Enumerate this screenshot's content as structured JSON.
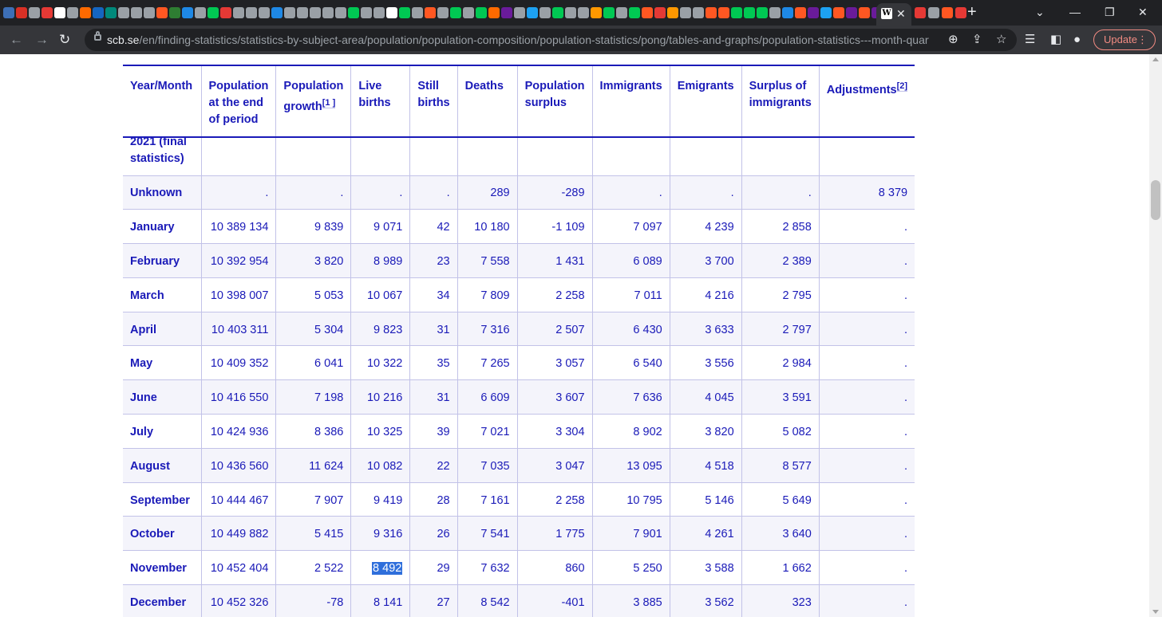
{
  "browser": {
    "active_tab_icon": "W",
    "url_host": "scb.se",
    "url_path": "/en/finding-statistics/statistics-by-subject-area/population/population-composition/population-statistics/pong/tables-and-graphs/population-statistics---month-quarter-...",
    "update_label": "Update",
    "tab_favicon_colors": [
      "#3d6fb6",
      "#d93025",
      "#9aa0a6",
      "#e53935",
      "#ffffff",
      "#9aa0a6",
      "#ff6a00",
      "#1565c0",
      "#00897b",
      "#9aa0a6",
      "#9aa0a6",
      "#9aa0a6",
      "#ff5722",
      "#2e7d32",
      "#1e88e5",
      "#9aa0a6",
      "#00c853",
      "#e53935",
      "#9aa0a6",
      "#9aa0a6",
      "#9aa0a6",
      "#1e88e5",
      "#9aa0a6",
      "#9aa0a6",
      "#9aa0a6",
      "#9aa0a6",
      "#9aa0a6",
      "#00c853",
      "#9aa0a6",
      "#9aa0a6",
      "#ffffff",
      "#00c853",
      "#9aa0a6",
      "#ff5722",
      "#9aa0a6",
      "#00c853",
      "#9aa0a6",
      "#00c853",
      "#ff6a00",
      "#6a1b9a",
      "#9aa0a6",
      "#1da1f2",
      "#9aa0a6",
      "#00c853",
      "#9aa0a6",
      "#9aa0a6",
      "#ff9800",
      "#00c853",
      "#9aa0a6",
      "#00c853",
      "#ff5722",
      "#e53935",
      "#ff9800",
      "#9aa0a6",
      "#9aa0a6",
      "#ff5722",
      "#ff5722",
      "#00c853",
      "#00c853",
      "#00c853",
      "#9aa0a6",
      "#1e88e5",
      "#ff5722",
      "#6a1b9a",
      "#1da1f2",
      "#ff5722",
      "#6a1b9a",
      "#ff5722",
      "#6a1b9a",
      "#ff6a00",
      "#9aa0a6"
    ]
  },
  "table": {
    "headers": [
      {
        "text": "Year/Month",
        "sup": ""
      },
      {
        "text": "Population at the end of period",
        "sup": ""
      },
      {
        "text": "Population growth",
        "sup": "[1 ]"
      },
      {
        "text": "Live births",
        "sup": ""
      },
      {
        "text": "Still births",
        "sup": ""
      },
      {
        "text": "Deaths",
        "sup": ""
      },
      {
        "text": "Population surplus",
        "sup": ""
      },
      {
        "text": "Immigrants",
        "sup": ""
      },
      {
        "text": "Emigrants",
        "sup": ""
      },
      {
        "text": "Surplus of immigrants",
        "sup": ""
      },
      {
        "text": "Adjustments",
        "sup": "[2]"
      }
    ],
    "section_label": "2021 (final statistics)",
    "rows": [
      {
        "label": "Unknown",
        "cells": [
          ".",
          ".",
          ".",
          ".",
          "289",
          "-289",
          ".",
          ".",
          ".",
          "8 379"
        ]
      },
      {
        "label": "January",
        "cells": [
          "10 389 134",
          "9 839",
          "9 071",
          "42",
          "10 180",
          "-1 109",
          "7 097",
          "4 239",
          "2 858",
          "."
        ]
      },
      {
        "label": "February",
        "cells": [
          "10 392 954",
          "3 820",
          "8 989",
          "23",
          "7 558",
          "1 431",
          "6 089",
          "3 700",
          "2 389",
          "."
        ]
      },
      {
        "label": "March",
        "cells": [
          "10 398 007",
          "5 053",
          "10 067",
          "34",
          "7 809",
          "2 258",
          "7 011",
          "4 216",
          "2 795",
          "."
        ]
      },
      {
        "label": "April",
        "cells": [
          "10 403 311",
          "5 304",
          "9 823",
          "31",
          "7 316",
          "2 507",
          "6 430",
          "3 633",
          "2 797",
          "."
        ]
      },
      {
        "label": "May",
        "cells": [
          "10 409 352",
          "6 041",
          "10 322",
          "35",
          "7 265",
          "3 057",
          "6 540",
          "3 556",
          "2 984",
          "."
        ]
      },
      {
        "label": "June",
        "cells": [
          "10 416 550",
          "7 198",
          "10 216",
          "31",
          "6 609",
          "3 607",
          "7 636",
          "4 045",
          "3 591",
          "."
        ]
      },
      {
        "label": "July",
        "cells": [
          "10 424 936",
          "8 386",
          "10 325",
          "39",
          "7 021",
          "3 304",
          "8 902",
          "3 820",
          "5 082",
          "."
        ]
      },
      {
        "label": "August",
        "cells": [
          "10 436 560",
          "11 624",
          "10 082",
          "22",
          "7 035",
          "3 047",
          "13 095",
          "4 518",
          "8 577",
          "."
        ]
      },
      {
        "label": "September",
        "cells": [
          "10 444 467",
          "7 907",
          "9 419",
          "28",
          "7 161",
          "2 258",
          "10 795",
          "5 146",
          "5 649",
          "."
        ]
      },
      {
        "label": "October",
        "cells": [
          "10 449 882",
          "5 415",
          "9 316",
          "26",
          "7 541",
          "1 775",
          "7 901",
          "4 261",
          "3 640",
          "."
        ]
      },
      {
        "label": "November",
        "cells": [
          "10 452 404",
          "2 522",
          "8 492",
          "29",
          "7 632",
          "860",
          "5 250",
          "3 588",
          "1 662",
          "."
        ]
      },
      {
        "label": "December",
        "cells": [
          "10 452 326",
          "-78",
          "8 141",
          "27",
          "8 542",
          "-401",
          "3 885",
          "3 562",
          "323",
          "."
        ]
      }
    ],
    "highlighted_cell": {
      "row": "November",
      "column": "Live births",
      "value": "8 492"
    },
    "colors": {
      "text": "#1a1ab8",
      "row_alt": "#f4f4fb",
      "grid": "#c2c2e8",
      "selection": "#2f6fdb"
    }
  }
}
